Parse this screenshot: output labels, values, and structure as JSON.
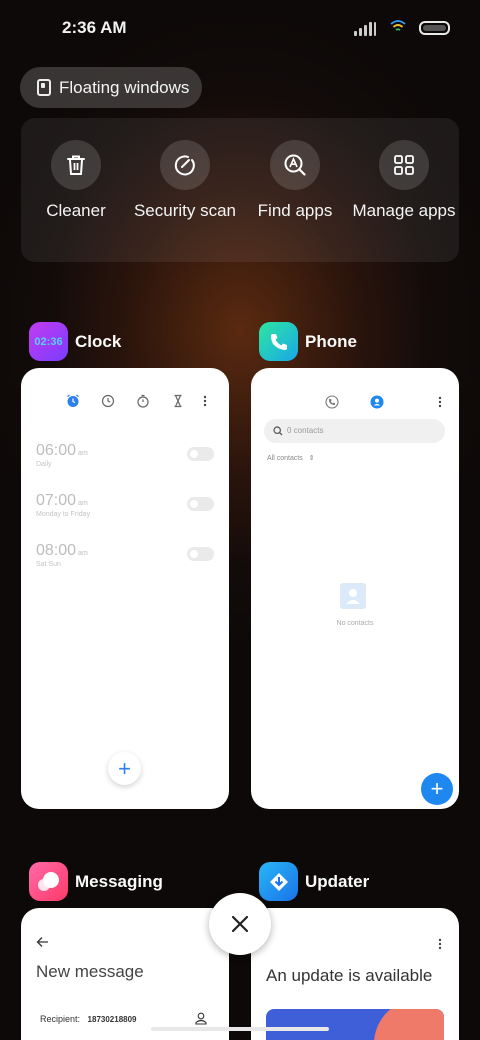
{
  "status_bar": {
    "time": "2:36 AM"
  },
  "floating_windows": {
    "label": "Floating windows"
  },
  "tools": [
    {
      "label": "Cleaner",
      "icon": "trash-icon"
    },
    {
      "label": "Security scan",
      "icon": "security-scan-icon"
    },
    {
      "label": "Find apps",
      "icon": "find-apps-icon"
    },
    {
      "label": "Manage apps",
      "icon": "grid-icon"
    }
  ],
  "apps": {
    "clock": {
      "name": "Clock",
      "icon_text": "02:36",
      "alarms": [
        {
          "time": "06:00",
          "ampm": "am",
          "sub": "Daily"
        },
        {
          "time": "07:00",
          "ampm": "am",
          "sub": "Monday to Friday"
        },
        {
          "time": "08:00",
          "ampm": "am",
          "sub": "Sat Sun"
        }
      ]
    },
    "phone": {
      "name": "Phone",
      "search_placeholder": "0 contacts",
      "filter": "All contacts",
      "empty_text": "No contacts"
    },
    "messaging": {
      "name": "Messaging",
      "title": "New message",
      "recipient_label": "Recipient:",
      "recipient_value": "18730218809"
    },
    "updater": {
      "name": "Updater",
      "title": "An update is available"
    }
  },
  "colors": {
    "accent_blue": "#2d7ff0",
    "fab_blue": "#1e88f0",
    "phone_icon_gradient": [
      "#2ee6a0",
      "#18a8e8"
    ],
    "messaging_icon_gradient": [
      "#ff5aa0",
      "#ff3a6a"
    ],
    "updater_icon_gradient": [
      "#29b6f6",
      "#1a73e8"
    ]
  }
}
